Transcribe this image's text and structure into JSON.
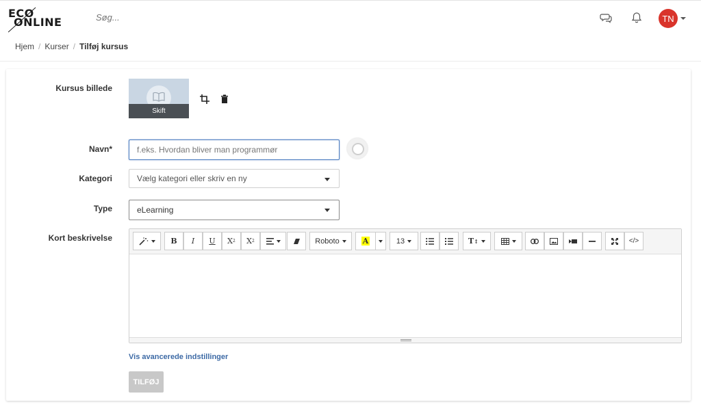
{
  "header": {
    "logo_line1": "ECO",
    "logo_line2": "ONLINE",
    "search_placeholder": "Søg...",
    "avatar_initials": "TN",
    "icons": [
      "chat-icon",
      "bell-icon"
    ]
  },
  "breadcrumb": {
    "items": [
      "Hjem",
      "Kurser"
    ],
    "current": "Tilføj kursus"
  },
  "form": {
    "image": {
      "label": "Kursus billede",
      "change_label": "Skift"
    },
    "name": {
      "label": "Navn*",
      "placeholder": "f.eks. Hvordan bliver man programmør",
      "value": ""
    },
    "category": {
      "label": "Kategori",
      "placeholder": "Vælg kategori eller skriv en ny"
    },
    "type": {
      "label": "Type",
      "value": "eLearning"
    },
    "description": {
      "label": "Kort beskrivelse",
      "toolbar": {
        "bold": "B",
        "italic": "I",
        "underline": "U",
        "superscript": "X",
        "subscript": "X",
        "font_name": "Roboto",
        "font_color": "A",
        "font_size": "13",
        "text_height": "T",
        "code": "</>"
      }
    },
    "advanced_link": "Vis avancerede indstillinger",
    "submit_label": "TILFØJ"
  },
  "colors": {
    "avatar_bg": "#d9342b",
    "link": "#3d6aa5",
    "focus_border": "#4a7bbf",
    "disabled_button": "#c8c8c8",
    "highlight_yellow": "#ffff00"
  }
}
